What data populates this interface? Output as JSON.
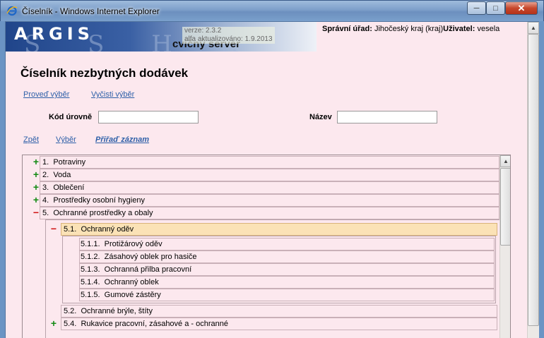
{
  "window": {
    "title": "Číselník - Windows Internet Explorer",
    "minimize": "─",
    "maximize": "□",
    "close": "✕"
  },
  "header": {
    "logo": "ARGIS",
    "logo_ghost": "S S H R",
    "server": "cvičný server",
    "version_line1": "verze: 2.3.2",
    "version_line2": "alfa aktualizováno: 1.9.2013",
    "office_label": "Správní úřad:",
    "office_value": "Jihočeský kraj (kraj)",
    "user_label": "Uživatel:",
    "user_value": "vesela"
  },
  "page": {
    "title": "Číselník nezbytných dodávek",
    "actions": [
      "Proveď výběr",
      "Vyčisti výběr"
    ],
    "filters": {
      "code_label": "Kód úrovně",
      "code_value": "",
      "name_label": "Název",
      "name_value": ""
    },
    "nav": [
      "Zpět",
      "Výběr",
      "Přiřaď záznam"
    ]
  },
  "tree": {
    "items": [
      {
        "code": "1.",
        "label": "Potraviny",
        "state": "collapsed"
      },
      {
        "code": "2.",
        "label": "Voda",
        "state": "collapsed"
      },
      {
        "code": "3.",
        "label": "Oblečení",
        "state": "collapsed"
      },
      {
        "code": "4.",
        "label": "Prostředky osobní hygieny",
        "state": "collapsed"
      },
      {
        "code": "5.",
        "label": "Ochranné prostředky a obaly",
        "state": "expanded"
      }
    ],
    "sub5": [
      {
        "code": "5.1.",
        "label": "Ochranný oděv",
        "state": "expanded",
        "selected": true
      },
      {
        "code": "5.2.",
        "label": "Ochranné brýle, štíty",
        "state": "leaf"
      },
      {
        "code": "5.4.",
        "label": "Rukavice pracovní, zásahové a - ochranné",
        "state": "collapsed"
      }
    ],
    "sub51": [
      {
        "code": "5.1.1.",
        "label": "Protižárový oděv"
      },
      {
        "code": "5.1.2.",
        "label": "Zásahový oblek pro hasiče"
      },
      {
        "code": "5.1.3.",
        "label": "Ochranná přilba pracovní"
      },
      {
        "code": "5.1.4.",
        "label": "Ochranný oblek"
      },
      {
        "code": "5.1.5.",
        "label": "Gumové zástěry"
      }
    ]
  },
  "icons": {
    "plus": "+",
    "minus": "−",
    "up": "▲",
    "down": "▼"
  }
}
